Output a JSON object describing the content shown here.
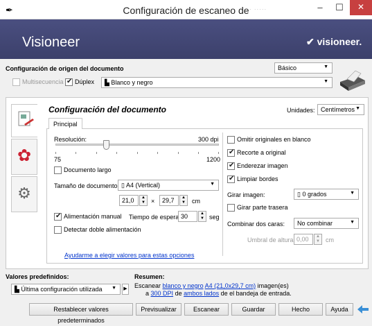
{
  "window": {
    "title": "Configuración de escaneo de",
    "title_suffix": "· ·····",
    "minimize": "–",
    "maximize": "☐",
    "close": "✕"
  },
  "banner": {
    "brand": "Visioneer",
    "logo": "visioneer."
  },
  "source": {
    "heading": "Configuración de origen del documento",
    "preset": "Básico",
    "multi_label": "Multisecuencia",
    "duplex_label": "Dúplex",
    "mode_value": "Blanco y negro"
  },
  "doc": {
    "heading": "Configuración del documento",
    "units_label": "Unidades:",
    "units_value": "Centímetros",
    "tab_principal": "Principal"
  },
  "left": {
    "resolution_label": "Resolución:",
    "resolution_value": "300 dpi",
    "slider_min": "75",
    "slider_max": "1200",
    "slider_level": 0.31,
    "long_doc_label": "Documento largo",
    "size_label": "Tamaño de documento:",
    "size_value": "A4 (Vertical)",
    "width_value": "21,0",
    "times": "×",
    "height_value": "29,7",
    "unit": "cm",
    "manual_feed_label": "Alimentación manual",
    "wait_label": "Tiempo de espera:",
    "wait_value": "30",
    "wait_unit": "seg",
    "double_feed_label": "Detectar doble alimentación",
    "help_link": "Ayudarme a elegir valores para estas opciones"
  },
  "right": {
    "skip_blank_label": "Omitir originales en blanco",
    "crop_label": "Recorte a original",
    "straighten_label": "Enderezar imagen",
    "clean_edges_label": "Limpiar bordes",
    "rotate_label": "Girar imagen:",
    "rotate_value": "0 grados",
    "flip_back_label": "Girar parte trasera",
    "combine_label": "Combinar dos caras:",
    "combine_value": "No combinar",
    "height_threshold_label": "Umbral de altura:",
    "height_threshold_value": "0,00",
    "height_threshold_unit": "cm"
  },
  "presets": {
    "heading": "Valores predefinidos:",
    "value": "Última configuración utilizada"
  },
  "summary": {
    "heading": "Resumen:",
    "line1_prefix": "Escanear",
    "line1_link1": "blanco y negro",
    "line1_link2": "A4 (21,0x29,7 cm)",
    "line1_suffix": "imagen(es)",
    "line2_prefix": "a",
    "line2_link1": "300 DPI",
    "line2_mid": "de",
    "line2_link2": "ambos lados",
    "line2_suffix": "de el bandeja de entrada."
  },
  "buttons": {
    "reset": "Restablecer valores predeterminados",
    "preview": "Previsualizar",
    "scan": "Escanear",
    "save": "Guardar",
    "done": "Hecho",
    "help": "Ayuda"
  }
}
